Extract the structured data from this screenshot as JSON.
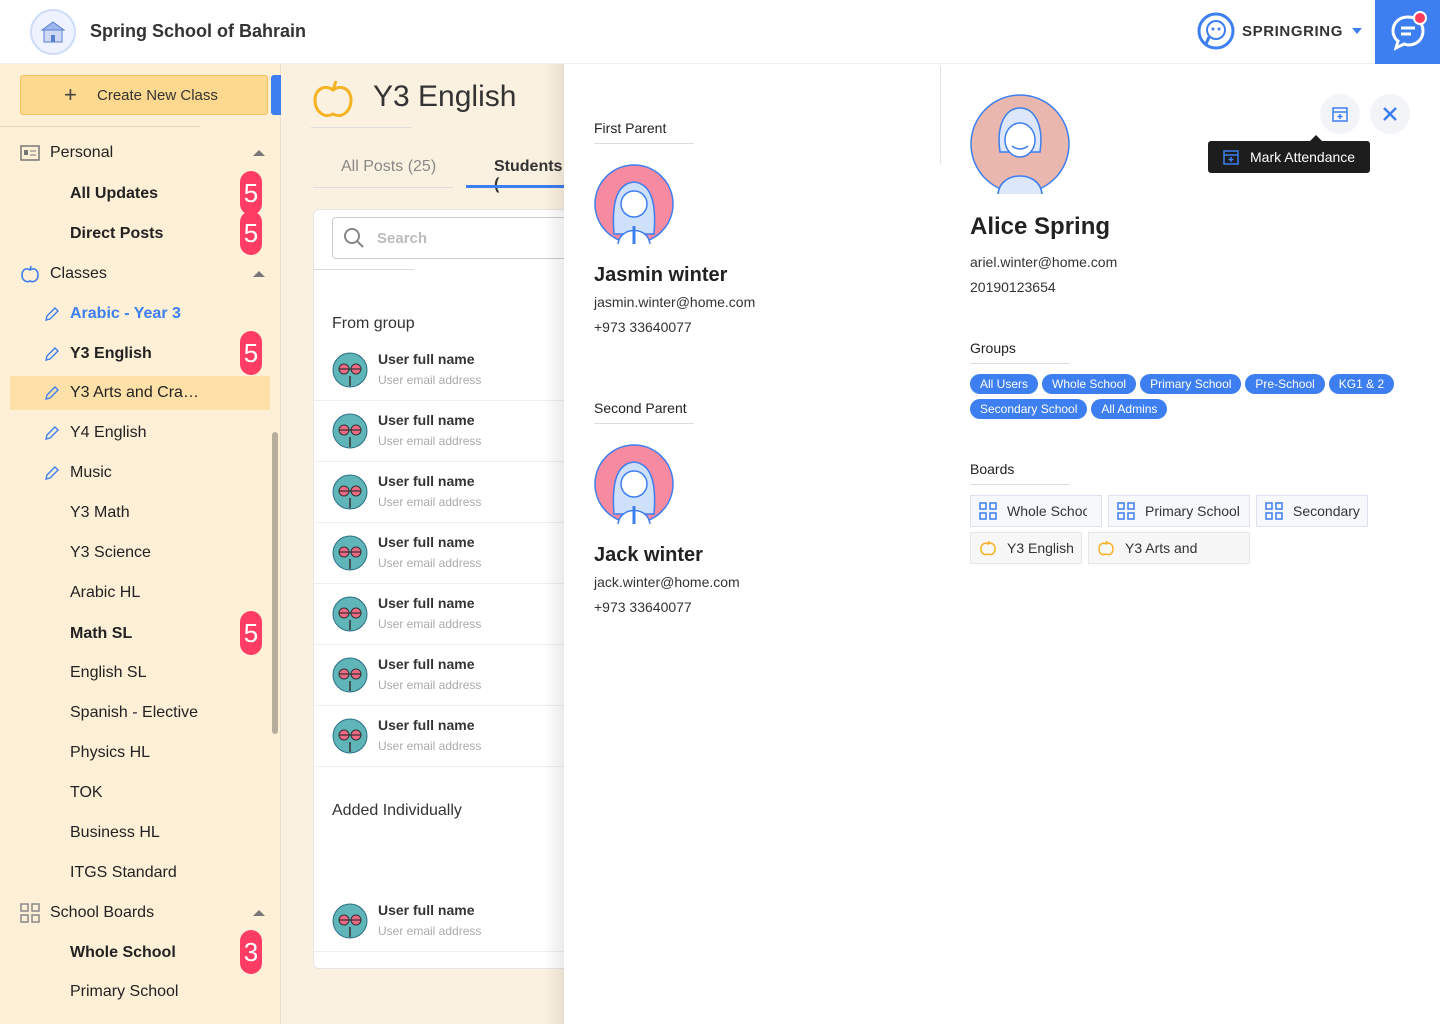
{
  "header": {
    "school_name": "Spring School of Bahrain",
    "brand": "SPRINGRING",
    "accent": "#3d7ef0",
    "notification_color": "#ff3b5c"
  },
  "sidebar": {
    "create_label": "Create New Class",
    "personal": {
      "label": "Personal",
      "items": [
        {
          "label": "All Updates",
          "badge": "5"
        },
        {
          "label": "Direct Posts",
          "badge": "5"
        }
      ]
    },
    "classes": {
      "label": "Classes",
      "items": [
        {
          "label": "Arabic - Year 3"
        },
        {
          "label": "Y3 English",
          "badge": "5"
        },
        {
          "label": "Y3 Arts and Cra…"
        },
        {
          "label": "Y4 English"
        },
        {
          "label": "Music"
        },
        {
          "label": "Y3 Math"
        },
        {
          "label": "Y3 Science"
        },
        {
          "label": "Arabic HL"
        },
        {
          "label": "Math SL",
          "badge": "5"
        },
        {
          "label": "English SL"
        },
        {
          "label": "Spanish - Elective"
        },
        {
          "label": "Physics HL"
        },
        {
          "label": "TOK"
        },
        {
          "label": "Business HL"
        },
        {
          "label": "ITGS Standard"
        }
      ]
    },
    "boards": {
      "label": "School Boards",
      "items": [
        {
          "label": "Whole School",
          "badge": "3"
        },
        {
          "label": "Primary School"
        }
      ]
    }
  },
  "main": {
    "title": "Y3 English",
    "tabs": [
      {
        "label": "All Posts (25)"
      },
      {
        "label": "Students ("
      }
    ],
    "search_placeholder": "Search",
    "from_group_label": "From group",
    "added_individually_label": "Added Individually",
    "users": [
      {
        "name": "User full name",
        "email": "User email address"
      },
      {
        "name": "User full name",
        "email": "User email address"
      },
      {
        "name": "User full name",
        "email": "User email address"
      },
      {
        "name": "User full name",
        "email": "User email address"
      },
      {
        "name": "User full name",
        "email": "User email address"
      },
      {
        "name": "User full name",
        "email": "User email address"
      },
      {
        "name": "User full name",
        "email": "User email address"
      }
    ],
    "individual_users": [
      {
        "name": "User full name",
        "email": "User email address"
      }
    ]
  },
  "panel": {
    "first_parent": {
      "label": "First Parent",
      "name": "Jasmin winter",
      "email": "jasmin.winter@home.com",
      "phone": "+973 33640077"
    },
    "second_parent": {
      "label": "Second Parent",
      "name": "Jack winter",
      "email": "jack.winter@home.com",
      "phone": "+973 33640077"
    },
    "student": {
      "name": "Alice Spring",
      "email": "ariel.winter@home.com",
      "id": "20190123654"
    },
    "groups_label": "Groups",
    "groups": [
      "All Users",
      "Whole School",
      "Primary School",
      "Pre-School",
      "KG1 & 2",
      "Secondary School",
      "All Admins"
    ],
    "boards_label": "Boards",
    "boards": [
      {
        "label": "Whole School",
        "icon": "grid-icon"
      },
      {
        "label": "Primary School",
        "icon": "grid-icon"
      },
      {
        "label": "Secondary",
        "icon": "grid-icon"
      },
      {
        "label": "Y3 English",
        "icon": "apple-icon"
      },
      {
        "label": "Y3 Arts and",
        "icon": "apple-icon"
      }
    ],
    "tooltip": "Mark Attendance"
  }
}
